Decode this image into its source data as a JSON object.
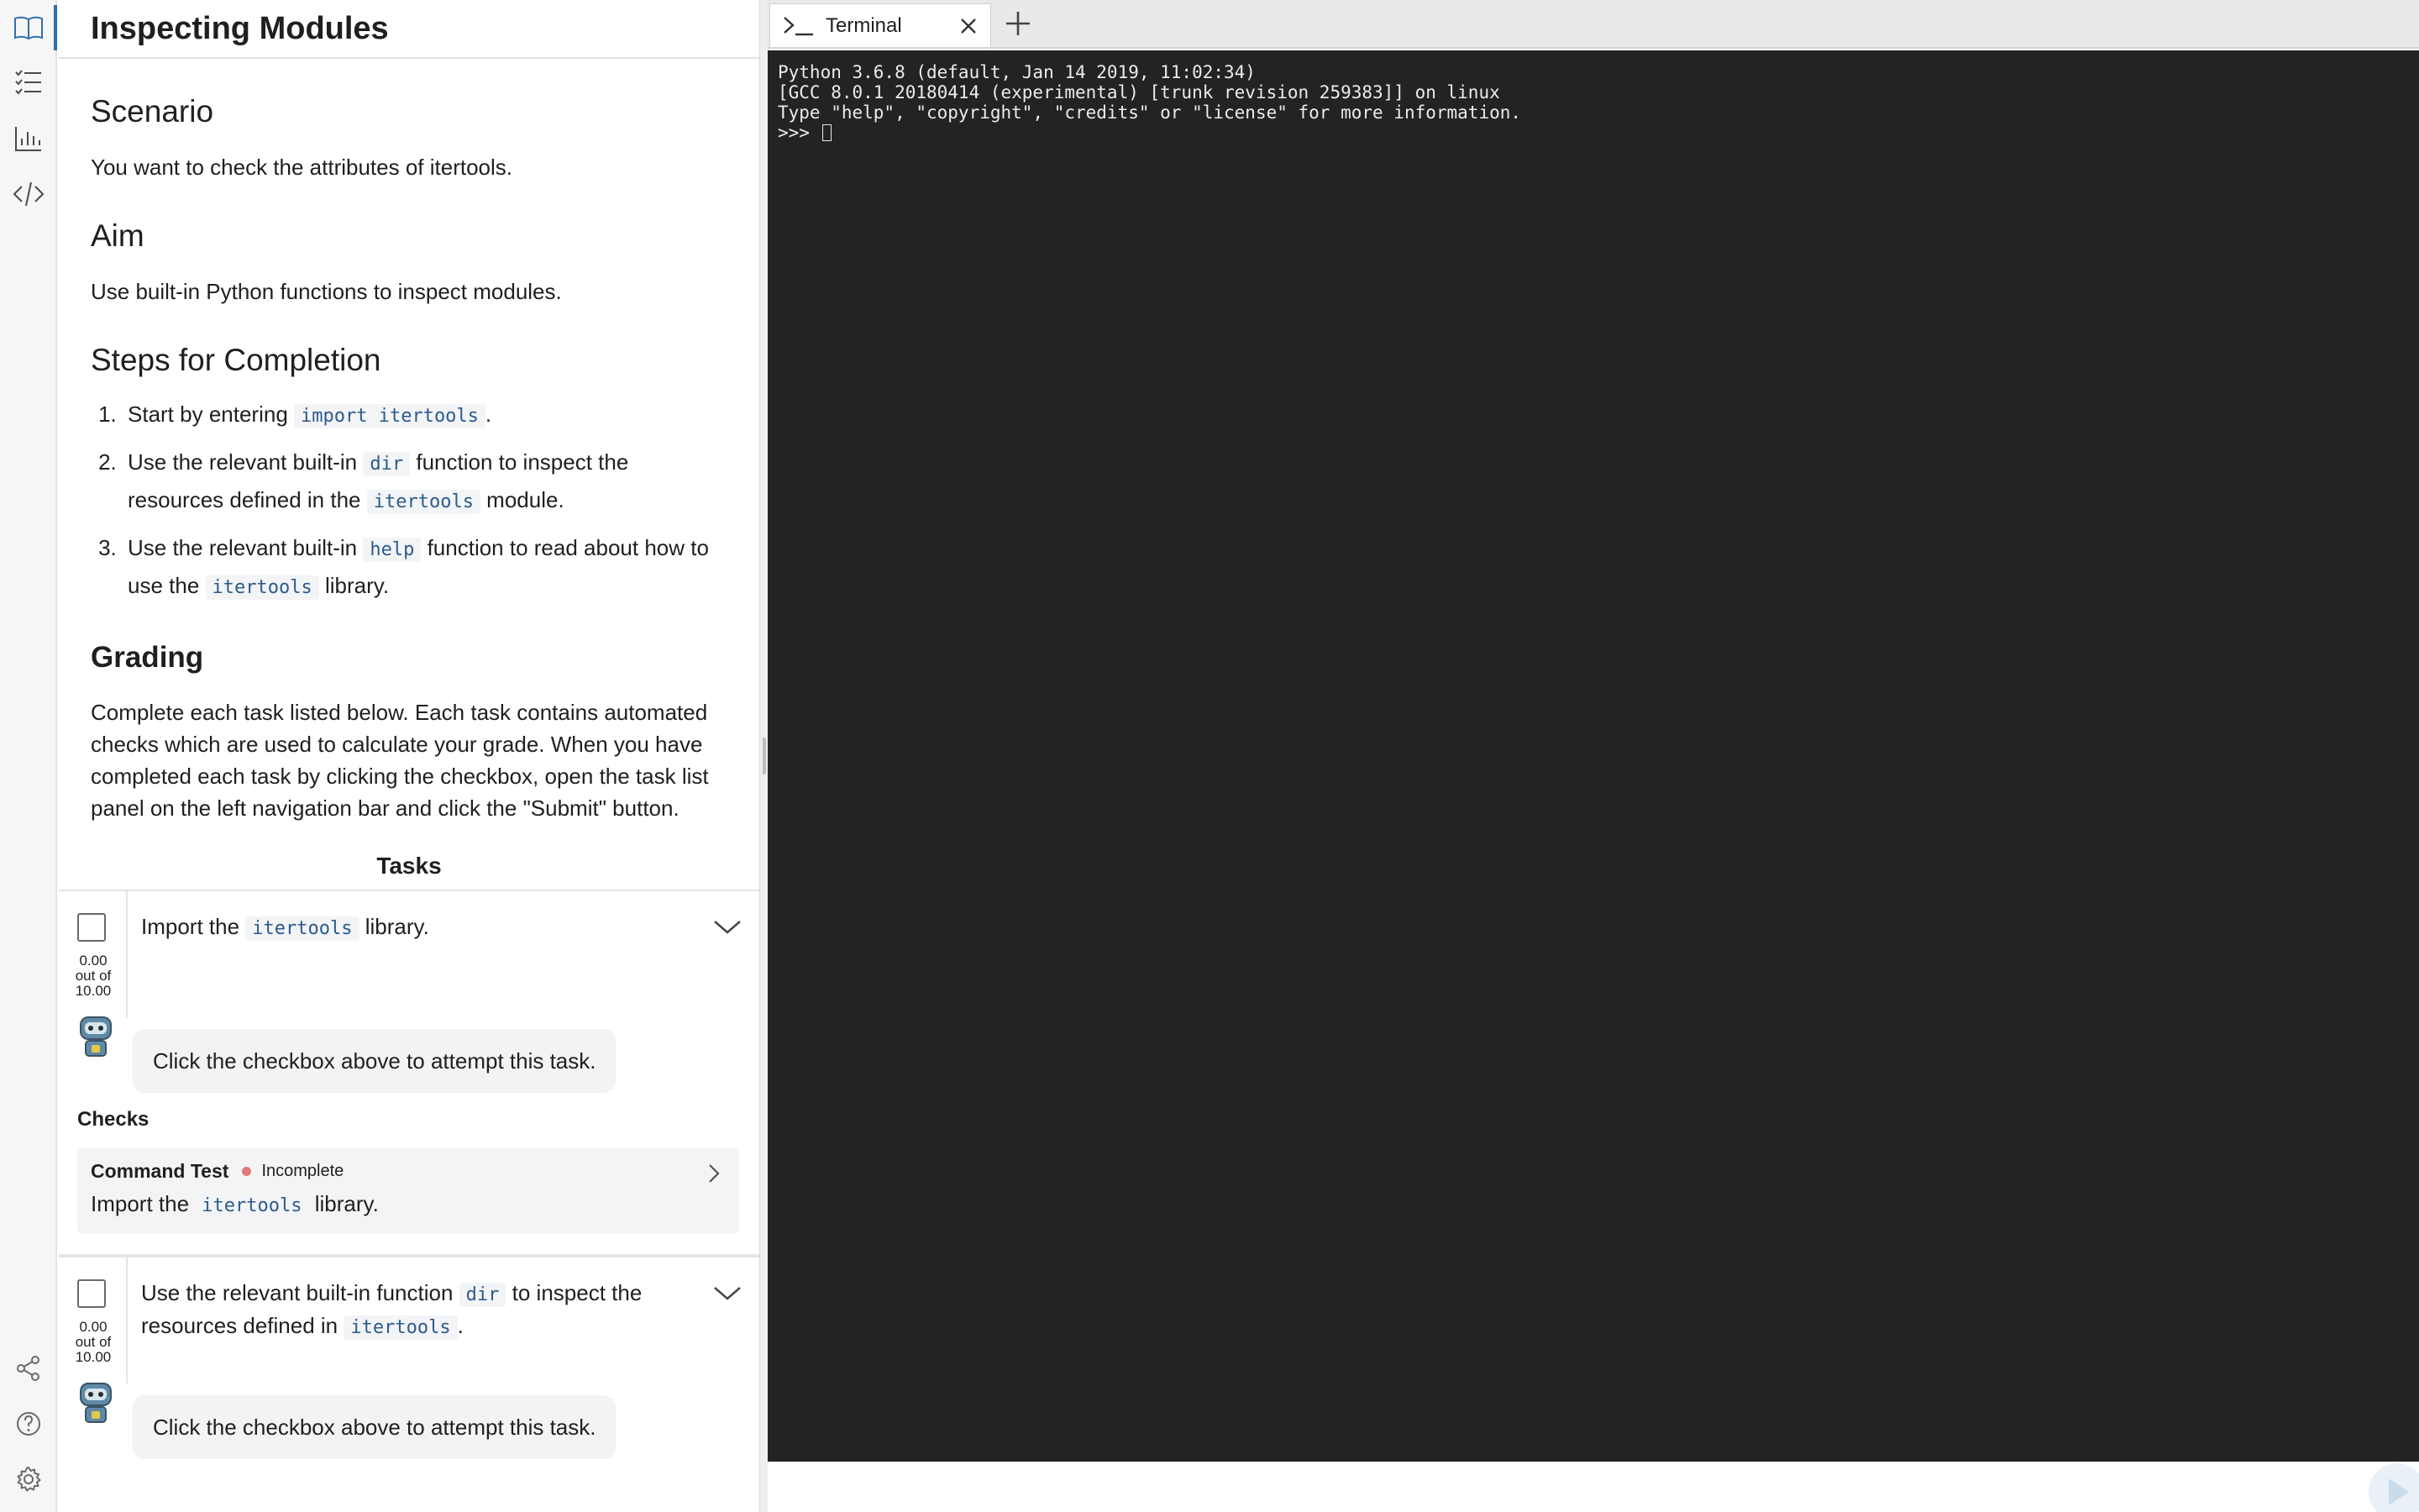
{
  "rail": {
    "items": [
      {
        "name": "book-icon",
        "active": true
      },
      {
        "name": "task-list-icon",
        "active": false
      },
      {
        "name": "bar-chart-icon",
        "active": false
      },
      {
        "name": "code-icon",
        "active": false
      }
    ],
    "bottom": [
      "share-icon",
      "help-icon",
      "settings-icon"
    ]
  },
  "page": {
    "title": "Inspecting Modules",
    "scenario_heading": "Scenario",
    "scenario_text": "You want to check the attributes of itertools.",
    "aim_heading": "Aim",
    "aim_text": "Use built-in Python functions to inspect modules.",
    "steps_heading": "Steps for Completion",
    "steps": [
      {
        "before": "Start by entering ",
        "code": "import itertools",
        "after": "."
      },
      {
        "before": "Use the relevant built-in ",
        "code": "dir",
        "middle": " function to inspect the resources defined in the ",
        "code2": "itertools",
        "after": " module."
      },
      {
        "before": "Use the relevant built-in ",
        "code": "help",
        "middle": " function to read about how to use the ",
        "code2": "itertools",
        "after": " library."
      }
    ],
    "grading_heading": "Grading",
    "grading_text": "Complete each task listed below. Each task contains automated checks which are used to calculate your grade. When you have completed each task by clicking the checkbox, open the task list panel on the left navigation bar and click the \"Submit\" button.",
    "tasks_heading": "Tasks"
  },
  "tasks": [
    {
      "text_before": "Import the ",
      "code": "itertools",
      "text_after": " library.",
      "score": "0.00",
      "score_mid": "out of",
      "score_max": "10.00",
      "bubble": "Click the checkbox above to attempt this task.",
      "checks_label": "Checks",
      "check": {
        "name": "Command Test",
        "status": "Incomplete",
        "desc_before": "Import the ",
        "desc_code": "itertools",
        "desc_after": " library."
      }
    },
    {
      "text_before": "Use the relevant built-in function ",
      "code": "dir",
      "text_middle": " to inspect the resources defined in ",
      "code2": "itertools",
      "text_after": ".",
      "score": "0.00",
      "score_mid": "out of",
      "score_max": "10.00",
      "bubble": "Click the checkbox above to attempt this task."
    }
  ],
  "terminal": {
    "tab_label": "Terminal",
    "lines": [
      "Python 3.6.8 (default, Jan 14 2019, 11:02:34)",
      "[GCC 8.0.1 20180414 (experimental) [trunk revision 259383]] on linux",
      "Type \"help\", \"copyright\", \"credits\" or \"license\" for more information."
    ],
    "prompt": ">>> "
  },
  "colors": {
    "accent": "#2f6fb1",
    "terminal_bg": "#232323",
    "status_incomplete": "#e0787a"
  }
}
